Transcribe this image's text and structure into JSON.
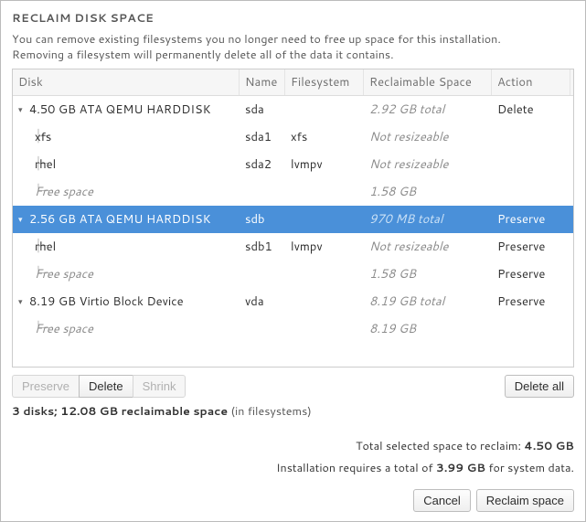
{
  "title": "RECLAIM DISK SPACE",
  "desc_line1": "You can remove existing filesystems you no longer need to free up space for this installation.",
  "desc_line2": "Removing a filesystem will permanently delete all of the data it contains.",
  "columns": {
    "disk": "Disk",
    "name": "Name",
    "fs": "Filesystem",
    "rec": "Reclaimable Space",
    "act": "Action"
  },
  "rows": [
    {
      "type": "disk",
      "caret": "▾",
      "label": "4.50 GB ATA QEMU HARDDISK",
      "name": "sda",
      "fs": "",
      "rec": "2.92 GB total",
      "recMuted": true,
      "act": "Delete"
    },
    {
      "type": "part",
      "branch": "├─",
      "label": "xfs",
      "name": "sda1",
      "fs": "xfs",
      "rec": "Not resizeable",
      "recMuted": true,
      "act": ""
    },
    {
      "type": "part",
      "branch": "├─",
      "label": "rhel",
      "name": "sda2",
      "fs": "lvmpv",
      "rec": "Not resizeable",
      "recMuted": true,
      "act": ""
    },
    {
      "type": "free",
      "branch": "└─",
      "label": "Free space",
      "name": "",
      "fs": "",
      "rec": "1.58 GB",
      "recMuted": true,
      "act": ""
    },
    {
      "type": "disk",
      "selected": true,
      "caret": "▾",
      "label": "2.56 GB ATA QEMU HARDDISK",
      "name": "sdb",
      "fs": "",
      "rec": "970 MB total",
      "recMuted": true,
      "act": "Preserve"
    },
    {
      "type": "part",
      "branch": "├─",
      "label": "rhel",
      "name": "sdb1",
      "fs": "lvmpv",
      "rec": "Not resizeable",
      "recMuted": true,
      "act": "Preserve"
    },
    {
      "type": "free",
      "branch": "└─",
      "label": "Free space",
      "name": "",
      "fs": "",
      "rec": "1.58 GB",
      "recMuted": true,
      "act": "Preserve"
    },
    {
      "type": "disk",
      "caret": "▾",
      "label": "8.19 GB Virtio Block Device",
      "name": "vda",
      "fs": "",
      "rec": "8.19 GB total",
      "recMuted": true,
      "act": "Preserve"
    },
    {
      "type": "free",
      "branch": "└─",
      "label": "Free space",
      "name": "",
      "fs": "",
      "rec": "8.19 GB",
      "recMuted": true,
      "act": ""
    }
  ],
  "buttons": {
    "preserve": "Preserve",
    "delete": "Delete",
    "shrink": "Shrink",
    "delete_all": "Delete all",
    "cancel": "Cancel",
    "reclaim": "Reclaim space"
  },
  "summary_bold": "3 disks; 12.08 GB reclaimable space",
  "summary_rest": " (in filesystems)",
  "total_label": "Total selected space to reclaim: ",
  "total_value": "4.50 GB",
  "req_pre": "Installation requires a total of ",
  "req_val": "3.99 GB",
  "req_post": " for system data."
}
